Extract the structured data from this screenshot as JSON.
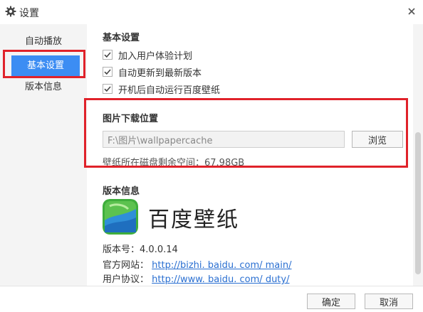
{
  "window": {
    "title": "设置",
    "title_icon": "gear-icon",
    "close_icon": "close-icon"
  },
  "sidebar": {
    "items": [
      {
        "label": "自动播放",
        "active": false
      },
      {
        "label": "基本设置",
        "active": true
      },
      {
        "label": "版本信息",
        "active": false
      }
    ]
  },
  "basic": {
    "title": "基本设置",
    "options": [
      {
        "label": "加入用户体验计划",
        "checked": true
      },
      {
        "label": "自动更新到最新版本",
        "checked": true
      },
      {
        "label": "开机后自动运行百度壁纸",
        "checked": true
      }
    ]
  },
  "download": {
    "title": "图片下载位置",
    "path": "F:\\图片\\wallpapercache",
    "browse_label": "浏览",
    "disk_space": "壁纸所在磁盘剩余空间：67.98GB"
  },
  "version": {
    "title": "版本信息",
    "app_name": "百度壁纸",
    "version_label": "版本号：",
    "version_value": "4.0.0.14",
    "site_label": "官方网站：",
    "site_link": "http://bizhi. baidu. com/ main/",
    "agreement_label": "用户协议：",
    "agreement_link": "http://www. baidu. com/ duty/"
  },
  "footer": {
    "ok_label": "确定",
    "cancel_label": "取消"
  },
  "colors": {
    "accent": "#3c8df3",
    "highlight_box": "#e0222a",
    "link": "#2a6fd1"
  }
}
